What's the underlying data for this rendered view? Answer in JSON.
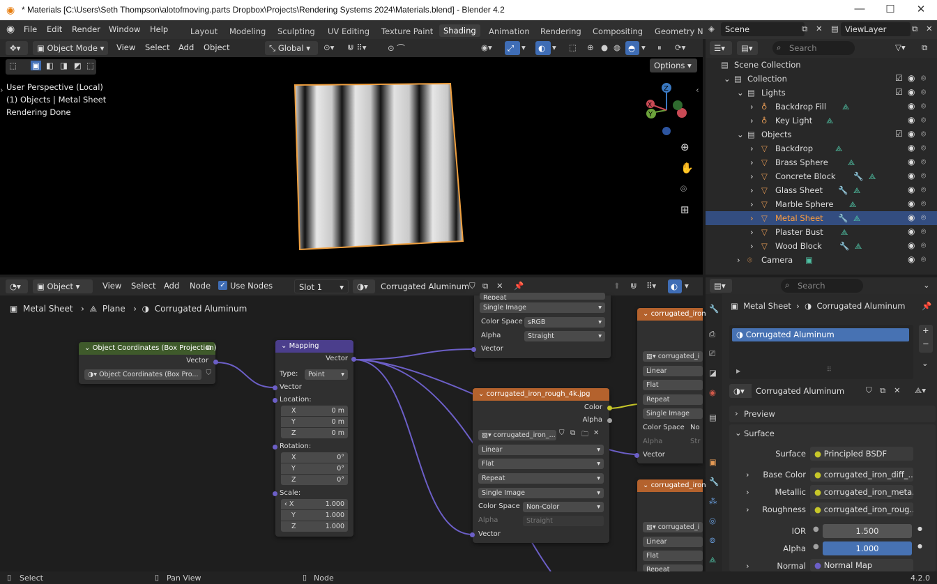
{
  "window": {
    "title": "* Materials [C:\\Users\\Seth Thompson\\alotofmoving.parts Dropbox\\Projects\\Rendering Systems 2024\\Materials.blend] - Blender 4.2"
  },
  "menu": {
    "file": "File",
    "edit": "Edit",
    "render": "Render",
    "window": "Window",
    "help": "Help"
  },
  "workspaces": [
    "Layout",
    "Modeling",
    "Sculpting",
    "UV Editing",
    "Texture Paint",
    "Shading",
    "Animation",
    "Rendering",
    "Compositing",
    "Geometry N"
  ],
  "scene": {
    "name": "Scene",
    "view_layer": "ViewLayer"
  },
  "viewport": {
    "mode": "Object Mode",
    "view": "View",
    "select": "Select",
    "add": "Add",
    "object": "Object",
    "orientation": "Global",
    "options": "Options",
    "info": [
      "User Perspective (Local)",
      "(1) Objects | Metal Sheet",
      "Rendering Done"
    ],
    "gizmo": {
      "z": "Z",
      "x": "X",
      "y": "Y"
    }
  },
  "outliner": {
    "search_placeholder": "Search",
    "scene_collection": "Scene Collection",
    "collection": "Collection",
    "lights": "Lights",
    "light_items": [
      "Backdrop Fill",
      "Key Light"
    ],
    "objects": "Objects",
    "object_items": [
      "Backdrop",
      "Brass Sphere",
      "Concrete Block",
      "Glass Sheet",
      "Marble Sphere",
      "Metal Sheet",
      "Plaster Bust",
      "Wood Block"
    ],
    "camera": "Camera",
    "selected": "Metal Sheet"
  },
  "node_editor": {
    "type": "Object",
    "view": "View",
    "select": "Select",
    "add": "Add",
    "node": "Node",
    "use_nodes": "Use Nodes",
    "slot": "Slot 1",
    "material": "Corrugated Aluminum",
    "breadcrumb": [
      "Metal Sheet",
      "Plane",
      "Corrugated Aluminum"
    ],
    "nodes": {
      "objcoords": {
        "title": "Object Coordinates (Box Projection)",
        "out": "Vector",
        "group": "Object Coordinates (Box Pro..."
      },
      "mapping": {
        "title": "Mapping",
        "out": "Vector",
        "type_label": "Type:",
        "type_value": "Point",
        "vector": "Vector",
        "location": "Location:",
        "rotation": "Rotation:",
        "scale": "Scale:",
        "loc": [
          "0 m",
          "0 m",
          "0 m"
        ],
        "rot": [
          "0°",
          "0°",
          "0°"
        ],
        "scl": [
          "1.000",
          "1.000",
          "1.000"
        ],
        "axes": [
          "X",
          "Y",
          "Z"
        ]
      },
      "img_top": {
        "repeat": "Repeat",
        "single": "Single Image",
        "cs_label": "Color Space",
        "cs": "sRGB",
        "alpha_label": "Alpha",
        "alpha": "Straight",
        "vector": "Vector"
      },
      "img_rough": {
        "title": "corrugated_iron_rough_4k.jpg",
        "color": "Color",
        "alpha": "Alpha",
        "image": "corrugated_iron_...",
        "interp": "Linear",
        "proj": "Flat",
        "ext": "Repeat",
        "src": "Single Image",
        "cs_label": "Color Space",
        "cs": "Non-Color",
        "alpha_label": "Alpha",
        "alpha_mode": "Straight",
        "vector": "Vector"
      },
      "img_right1": {
        "title": "corrugated_iron_",
        "image": "corrugated_i",
        "interp": "Linear",
        "proj": "Flat",
        "ext": "Repeat",
        "src": "Single Image",
        "cs_label": "Color Space",
        "cs": "No",
        "alpha_label": "Alpha",
        "alpha_mode": "Str",
        "vector": "Vector"
      },
      "img_right2": {
        "title": "corrugated_iron_n",
        "image": "corrugated_i",
        "interp": "Linear",
        "proj": "Flat",
        "ext": "Repeat"
      }
    }
  },
  "properties": {
    "search_placeholder": "Search",
    "breadcrumb": [
      "Metal Sheet",
      "Corrugated Aluminum"
    ],
    "slot_item": "Corrugated Aluminum",
    "material": "Corrugated Aluminum",
    "preview": "Preview",
    "surface_panel": "Surface",
    "surface_label": "Surface",
    "surface_value": "Principled BSDF",
    "inputs": [
      {
        "label": "Base Color",
        "value": "corrugated_iron_diff_..."
      },
      {
        "label": "Metallic",
        "value": "corrugated_iron_meta..."
      },
      {
        "label": "Roughness",
        "value": "corrugated_iron_roug..."
      }
    ],
    "ior_label": "IOR",
    "ior": "1.500",
    "alpha_label": "Alpha",
    "alpha": "1.000",
    "normal_label": "Normal",
    "normal": "Normal Map"
  },
  "status": {
    "select": "Select",
    "pan": "Pan View",
    "node": "Node",
    "version": "4.2.0"
  },
  "colors": {
    "accent": "#3f6db5",
    "selected_orange": "#ff9e3d",
    "node_tex": "#b4622d",
    "node_vec": "#4b3e8c",
    "node_grp": "#3f5a2b",
    "socket_vec": "#6c5fc7",
    "socket_col": "#c7c729",
    "socket_float": "#a1a1a1"
  }
}
